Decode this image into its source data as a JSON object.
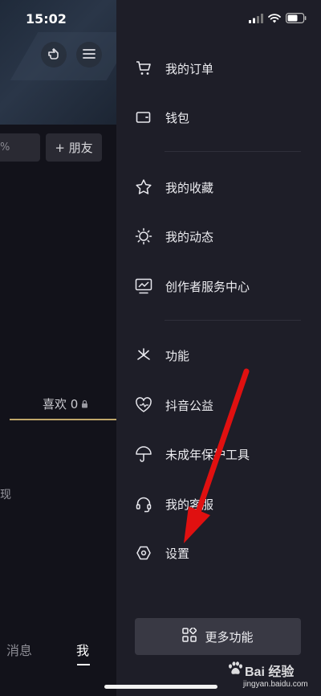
{
  "status_bar": {
    "time": "15:02"
  },
  "profile_bg": {
    "percent_text": "%",
    "add_friend_label": "+ 朋友",
    "likes_tab_label": "喜欢 0",
    "left_fragment": "现",
    "tab_messages": "消息",
    "tab_me": "我"
  },
  "drawer": {
    "items": [
      {
        "label": "我的订单",
        "icon": "cart-icon"
      },
      {
        "label": "钱包",
        "icon": "wallet-icon"
      },
      {
        "label": "我的收藏",
        "icon": "star-icon"
      },
      {
        "label": "我的动态",
        "icon": "sun-icon"
      },
      {
        "label": "创作者服务中心",
        "icon": "chart-icon"
      },
      {
        "label": "功能",
        "icon": "spark-icon"
      },
      {
        "label": "抖音公益",
        "icon": "heart-icon"
      },
      {
        "label": "未成年保护工具",
        "icon": "umbrella-icon"
      },
      {
        "label": "我的客服",
        "icon": "headset-icon"
      },
      {
        "label": "设置",
        "icon": "hex-settings-icon"
      }
    ],
    "more_label": "更多功能"
  },
  "watermark": {
    "brand": "Bai 经验",
    "url": "jingyan.baidu.com"
  },
  "colors": {
    "drawer_bg": "#1e1e28",
    "accent_arrow": "#e01010",
    "tab_underline": "#bfa76a"
  }
}
